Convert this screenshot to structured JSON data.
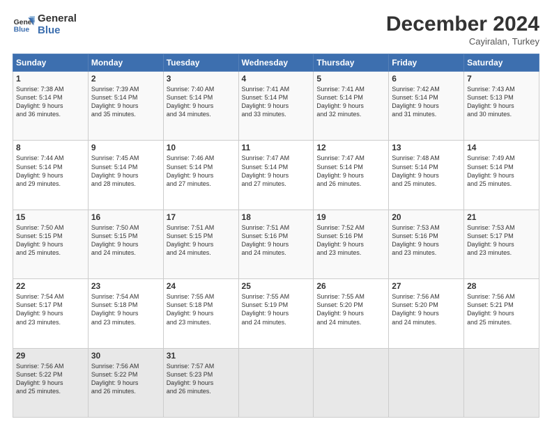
{
  "logo": {
    "line1": "General",
    "line2": "Blue"
  },
  "title": "December 2024",
  "location": "Cayiralan, Turkey",
  "days_header": [
    "Sunday",
    "Monday",
    "Tuesday",
    "Wednesday",
    "Thursday",
    "Friday",
    "Saturday"
  ],
  "weeks": [
    [
      {
        "day": "1",
        "lines": [
          "Sunrise: 7:38 AM",
          "Sunset: 5:14 PM",
          "Daylight: 9 hours",
          "and 36 minutes."
        ]
      },
      {
        "day": "2",
        "lines": [
          "Sunrise: 7:39 AM",
          "Sunset: 5:14 PM",
          "Daylight: 9 hours",
          "and 35 minutes."
        ]
      },
      {
        "day": "3",
        "lines": [
          "Sunrise: 7:40 AM",
          "Sunset: 5:14 PM",
          "Daylight: 9 hours",
          "and 34 minutes."
        ]
      },
      {
        "day": "4",
        "lines": [
          "Sunrise: 7:41 AM",
          "Sunset: 5:14 PM",
          "Daylight: 9 hours",
          "and 33 minutes."
        ]
      },
      {
        "day": "5",
        "lines": [
          "Sunrise: 7:41 AM",
          "Sunset: 5:14 PM",
          "Daylight: 9 hours",
          "and 32 minutes."
        ]
      },
      {
        "day": "6",
        "lines": [
          "Sunrise: 7:42 AM",
          "Sunset: 5:14 PM",
          "Daylight: 9 hours",
          "and 31 minutes."
        ]
      },
      {
        "day": "7",
        "lines": [
          "Sunrise: 7:43 AM",
          "Sunset: 5:13 PM",
          "Daylight: 9 hours",
          "and 30 minutes."
        ]
      }
    ],
    [
      {
        "day": "8",
        "lines": [
          "Sunrise: 7:44 AM",
          "Sunset: 5:14 PM",
          "Daylight: 9 hours",
          "and 29 minutes."
        ]
      },
      {
        "day": "9",
        "lines": [
          "Sunrise: 7:45 AM",
          "Sunset: 5:14 PM",
          "Daylight: 9 hours",
          "and 28 minutes."
        ]
      },
      {
        "day": "10",
        "lines": [
          "Sunrise: 7:46 AM",
          "Sunset: 5:14 PM",
          "Daylight: 9 hours",
          "and 27 minutes."
        ]
      },
      {
        "day": "11",
        "lines": [
          "Sunrise: 7:47 AM",
          "Sunset: 5:14 PM",
          "Daylight: 9 hours",
          "and 27 minutes."
        ]
      },
      {
        "day": "12",
        "lines": [
          "Sunrise: 7:47 AM",
          "Sunset: 5:14 PM",
          "Daylight: 9 hours",
          "and 26 minutes."
        ]
      },
      {
        "day": "13",
        "lines": [
          "Sunrise: 7:48 AM",
          "Sunset: 5:14 PM",
          "Daylight: 9 hours",
          "and 25 minutes."
        ]
      },
      {
        "day": "14",
        "lines": [
          "Sunrise: 7:49 AM",
          "Sunset: 5:14 PM",
          "Daylight: 9 hours",
          "and 25 minutes."
        ]
      }
    ],
    [
      {
        "day": "15",
        "lines": [
          "Sunrise: 7:50 AM",
          "Sunset: 5:15 PM",
          "Daylight: 9 hours",
          "and 25 minutes."
        ]
      },
      {
        "day": "16",
        "lines": [
          "Sunrise: 7:50 AM",
          "Sunset: 5:15 PM",
          "Daylight: 9 hours",
          "and 24 minutes."
        ]
      },
      {
        "day": "17",
        "lines": [
          "Sunrise: 7:51 AM",
          "Sunset: 5:15 PM",
          "Daylight: 9 hours",
          "and 24 minutes."
        ]
      },
      {
        "day": "18",
        "lines": [
          "Sunrise: 7:51 AM",
          "Sunset: 5:16 PM",
          "Daylight: 9 hours",
          "and 24 minutes."
        ]
      },
      {
        "day": "19",
        "lines": [
          "Sunrise: 7:52 AM",
          "Sunset: 5:16 PM",
          "Daylight: 9 hours",
          "and 23 minutes."
        ]
      },
      {
        "day": "20",
        "lines": [
          "Sunrise: 7:53 AM",
          "Sunset: 5:16 PM",
          "Daylight: 9 hours",
          "and 23 minutes."
        ]
      },
      {
        "day": "21",
        "lines": [
          "Sunrise: 7:53 AM",
          "Sunset: 5:17 PM",
          "Daylight: 9 hours",
          "and 23 minutes."
        ]
      }
    ],
    [
      {
        "day": "22",
        "lines": [
          "Sunrise: 7:54 AM",
          "Sunset: 5:17 PM",
          "Daylight: 9 hours",
          "and 23 minutes."
        ]
      },
      {
        "day": "23",
        "lines": [
          "Sunrise: 7:54 AM",
          "Sunset: 5:18 PM",
          "Daylight: 9 hours",
          "and 23 minutes."
        ]
      },
      {
        "day": "24",
        "lines": [
          "Sunrise: 7:55 AM",
          "Sunset: 5:18 PM",
          "Daylight: 9 hours",
          "and 23 minutes."
        ]
      },
      {
        "day": "25",
        "lines": [
          "Sunrise: 7:55 AM",
          "Sunset: 5:19 PM",
          "Daylight: 9 hours",
          "and 24 minutes."
        ]
      },
      {
        "day": "26",
        "lines": [
          "Sunrise: 7:55 AM",
          "Sunset: 5:20 PM",
          "Daylight: 9 hours",
          "and 24 minutes."
        ]
      },
      {
        "day": "27",
        "lines": [
          "Sunrise: 7:56 AM",
          "Sunset: 5:20 PM",
          "Daylight: 9 hours",
          "and 24 minutes."
        ]
      },
      {
        "day": "28",
        "lines": [
          "Sunrise: 7:56 AM",
          "Sunset: 5:21 PM",
          "Daylight: 9 hours",
          "and 25 minutes."
        ]
      }
    ],
    [
      {
        "day": "29",
        "lines": [
          "Sunrise: 7:56 AM",
          "Sunset: 5:22 PM",
          "Daylight: 9 hours",
          "and 25 minutes."
        ]
      },
      {
        "day": "30",
        "lines": [
          "Sunrise: 7:56 AM",
          "Sunset: 5:22 PM",
          "Daylight: 9 hours",
          "and 26 minutes."
        ]
      },
      {
        "day": "31",
        "lines": [
          "Sunrise: 7:57 AM",
          "Sunset: 5:23 PM",
          "Daylight: 9 hours",
          "and 26 minutes."
        ]
      },
      null,
      null,
      null,
      null
    ]
  ]
}
